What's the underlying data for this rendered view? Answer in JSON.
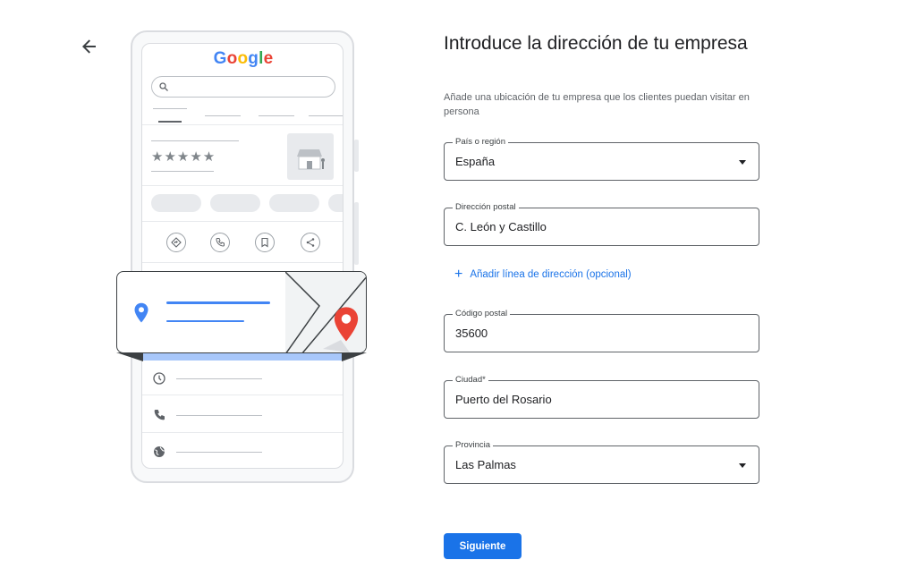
{
  "illustration": {
    "logo_text": "Google",
    "logo_colors": [
      "#4285F4",
      "#EA4335",
      "#FBBC05",
      "#4285F4",
      "#34A853",
      "#EA4335"
    ],
    "stars": "★★★★★",
    "icons": [
      "search-icon",
      "store-icon",
      "directions-icon",
      "phone-icon",
      "bookmark-icon",
      "share-icon",
      "location-pin-icon",
      "map-pin-icon",
      "clock-icon",
      "phone-icon",
      "globe-icon"
    ]
  },
  "form": {
    "title": "Introduce la dirección de tu empresa",
    "subtitle": "Añade una ubicación de tu empresa que los clientes puedan visitar en persona",
    "country": {
      "label": "País o región",
      "value": "España"
    },
    "street": {
      "label": "Dirección postal",
      "value": "C. León y Castillo"
    },
    "add_line": {
      "icon": "+",
      "label": "Añadir línea de dirección (opcional)"
    },
    "postal_code": {
      "label": "Código postal",
      "value": "35600"
    },
    "city": {
      "label": "Ciudad*",
      "value": "Puerto del Rosario"
    },
    "province": {
      "label": "Provincia",
      "value": "Las Palmas"
    },
    "next_button": "Siguiente"
  },
  "colors": {
    "accent": "#1a73e8",
    "pin_red": "#ea4335",
    "pin_blue": "#4285f4"
  }
}
